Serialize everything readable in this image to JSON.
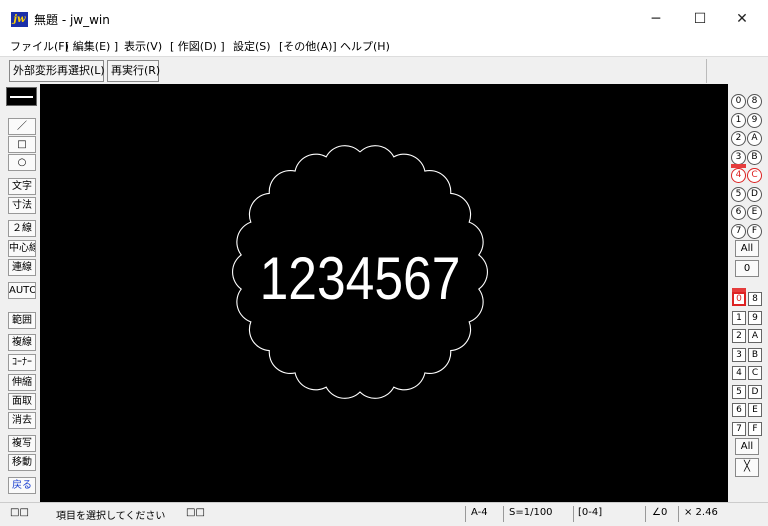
{
  "window": {
    "icon_text": "jw",
    "title": "無題 - jw_win",
    "minimize": "─",
    "maximize": "☐",
    "close": "✕"
  },
  "menu": [
    {
      "label": "ファイル(F)"
    },
    {
      "label": "[ 編集(E) ]"
    },
    {
      "label": "表示(V)"
    },
    {
      "label": "[ 作図(D) ]"
    },
    {
      "label": "設定(S)"
    },
    {
      "label": "[その他(A)]"
    },
    {
      "label": "ヘルプ(H)"
    }
  ],
  "toolbar": {
    "reselect_label": "外部変形再選択(L)",
    "redo_label": "再実行(R)"
  },
  "left_tools": [
    {
      "label": "／"
    },
    {
      "label": "□"
    },
    {
      "label": "○"
    },
    {
      "label": "文字"
    },
    {
      "label": "寸法"
    },
    {
      "label": "２線"
    },
    {
      "label": "中心線"
    },
    {
      "label": "連線"
    },
    {
      "label": "AUTO"
    },
    {
      "label": "範囲"
    },
    {
      "label": "複線"
    },
    {
      "label": "ｺｰﾅｰ"
    },
    {
      "label": "伸縮"
    },
    {
      "label": "面取"
    },
    {
      "label": "消去"
    },
    {
      "label": "複写"
    },
    {
      "label": "移動"
    },
    {
      "label": "戻る"
    }
  ],
  "canvas": {
    "text": "1234567",
    "shape": "scalloped-circle",
    "stroke_color": "#ffffff",
    "background_color": "#000000"
  },
  "layer_groups": [
    [
      "0",
      "8"
    ],
    [
      "1",
      "9"
    ],
    [
      "2",
      "A"
    ],
    [
      "3",
      "B"
    ],
    [
      "4",
      "C"
    ],
    [
      "5",
      "D"
    ],
    [
      "6",
      "E"
    ],
    [
      "7",
      "F"
    ]
  ],
  "layer_group_active": "4",
  "layer_group_all": "All",
  "layer_group_zero": "0",
  "layers": [
    [
      "0",
      "8"
    ],
    [
      "1",
      "9"
    ],
    [
      "2",
      "A"
    ],
    [
      "3",
      "B"
    ],
    [
      "4",
      "C"
    ],
    [
      "5",
      "D"
    ],
    [
      "6",
      "E"
    ],
    [
      "7",
      "F"
    ]
  ],
  "layer_active": "0",
  "layer_all": "All",
  "layer_x_icon": "╳",
  "status": {
    "left_icons": "□□",
    "message": "項目を選択してください",
    "mid_icons": "□□",
    "paper": "A-4",
    "scale": "S=1/100",
    "layer": "[0-4]",
    "angle": "∠0",
    "zoom": "× 2.46"
  },
  "colors": {
    "accent_red": "#e53c3c",
    "canvas_bg": "#000000",
    "app_icon_bg": "#1a2fa8",
    "app_icon_fg": "#ffd200"
  }
}
